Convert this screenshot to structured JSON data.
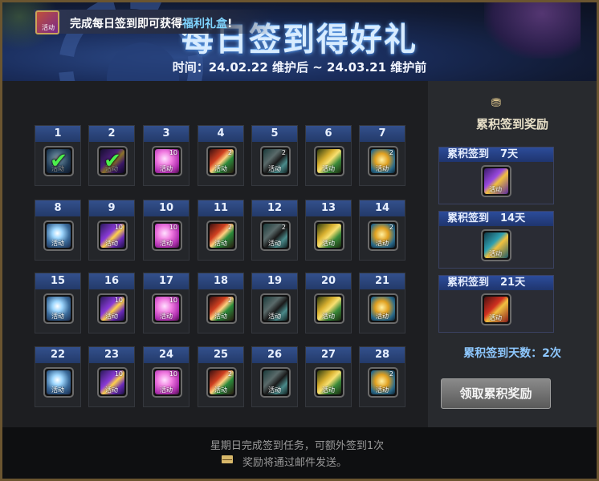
{
  "header": {
    "title": "每日签到得好礼",
    "time_text": "时间：24.02.22 维护后 ~ 24.03.21 维护前"
  },
  "banner": {
    "text_before": "完成每日签到即可获得",
    "highlight": "福利礼盒",
    "text_after": "!"
  },
  "tag_label": "活动",
  "days": [
    {
      "day": "1",
      "item": "crystal",
      "count": "",
      "checked": true
    },
    {
      "day": "2",
      "item": "sword-purple",
      "count": "",
      "checked": true
    },
    {
      "day": "3",
      "item": "pink-gem",
      "count": "10",
      "checked": false
    },
    {
      "day": "4",
      "item": "red-scroll",
      "count": "2",
      "checked": false
    },
    {
      "day": "5",
      "item": "dark-chest",
      "count": "2",
      "checked": false
    },
    {
      "day": "6",
      "item": "gold-ticket",
      "count": "",
      "checked": false
    },
    {
      "day": "7",
      "item": "gold-coin",
      "count": "2",
      "checked": false
    },
    {
      "day": "8",
      "item": "crystal",
      "count": "",
      "checked": false
    },
    {
      "day": "9",
      "item": "sword-purple",
      "count": "10",
      "checked": false
    },
    {
      "day": "10",
      "item": "pink-gem",
      "count": "10",
      "checked": false
    },
    {
      "day": "11",
      "item": "red-scroll",
      "count": "2",
      "checked": false
    },
    {
      "day": "12",
      "item": "dark-chest",
      "count": "2",
      "checked": false
    },
    {
      "day": "13",
      "item": "gold-ticket",
      "count": "",
      "checked": false
    },
    {
      "day": "14",
      "item": "gold-coin",
      "count": "2",
      "checked": false
    },
    {
      "day": "15",
      "item": "crystal",
      "count": "",
      "checked": false
    },
    {
      "day": "16",
      "item": "sword-purple",
      "count": "10",
      "checked": false
    },
    {
      "day": "17",
      "item": "pink-gem",
      "count": "10",
      "checked": false
    },
    {
      "day": "18",
      "item": "red-scroll",
      "count": "2",
      "checked": false
    },
    {
      "day": "19",
      "item": "dark-chest",
      "count": "",
      "checked": false
    },
    {
      "day": "20",
      "item": "gold-ticket",
      "count": "",
      "checked": false
    },
    {
      "day": "21",
      "item": "gold-coin",
      "count": "",
      "checked": false
    },
    {
      "day": "22",
      "item": "crystal",
      "count": "",
      "checked": false
    },
    {
      "day": "23",
      "item": "sword-purple",
      "count": "10",
      "checked": false
    },
    {
      "day": "24",
      "item": "pink-gem",
      "count": "10",
      "checked": false
    },
    {
      "day": "25",
      "item": "red-scroll",
      "count": "2",
      "checked": false
    },
    {
      "day": "26",
      "item": "dark-chest",
      "count": "",
      "checked": false
    },
    {
      "day": "27",
      "item": "gold-ticket",
      "count": "",
      "checked": false
    },
    {
      "day": "28",
      "item": "gold-coin",
      "count": "2",
      "checked": false
    }
  ],
  "reward_panel": {
    "title": "累积签到奖励",
    "items": [
      {
        "label": "累积签到",
        "days": "7天",
        "item": "gift-purple"
      },
      {
        "label": "累积签到",
        "days": "14天",
        "item": "gift-teal"
      },
      {
        "label": "累积签到",
        "days": "21天",
        "item": "gift-red"
      }
    ],
    "count_label": "累积签到天数：2次",
    "claim_button": "领取累积奖励"
  },
  "footer": {
    "note1": "星期日完成签到任务，可额外签到1次",
    "note2": "奖励将通过邮件发送。"
  },
  "colors": {
    "day_header": "#2d4a86",
    "check": "#4cf04c",
    "highlight": "#7fd4ff",
    "count_text": "#8ec8ff"
  }
}
